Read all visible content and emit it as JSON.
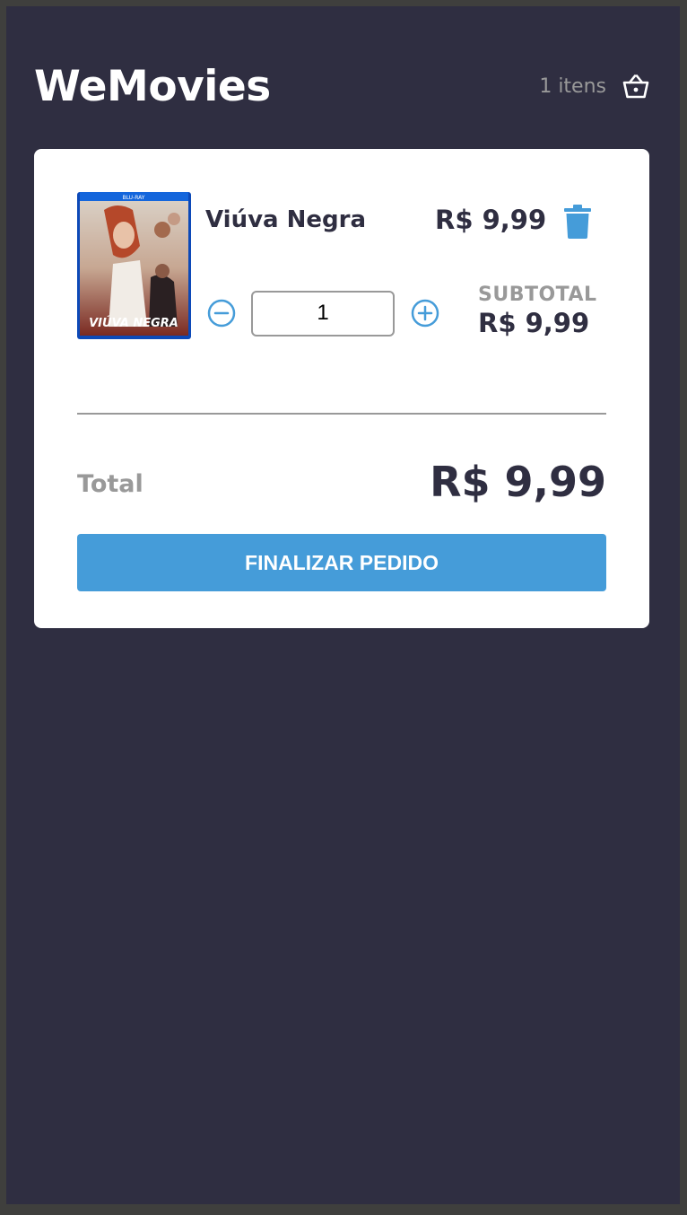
{
  "app": {
    "title": "WeMovies"
  },
  "header": {
    "cart_count": "1 itens",
    "cart_icon": "basket-icon"
  },
  "cart": {
    "items": [
      {
        "title": "Viúva Negra",
        "price": "R$ 9,99",
        "quantity": "1",
        "subtotal_label": "SUBTOTAL",
        "subtotal": "R$ 9,99",
        "poster_text": "VIÚVA NEGRA",
        "icons": {
          "delete": "trash-icon",
          "decrease": "minus-circle-icon",
          "increase": "plus-circle-icon"
        }
      }
    ],
    "total_label": "Total",
    "total": "R$ 9,99",
    "checkout_label": "FINALIZAR PEDIDO"
  },
  "colors": {
    "background": "#2f2e41",
    "card": "#ffffff",
    "accent": "#459cd9",
    "muted": "#999999",
    "text": "#2f2e41"
  }
}
